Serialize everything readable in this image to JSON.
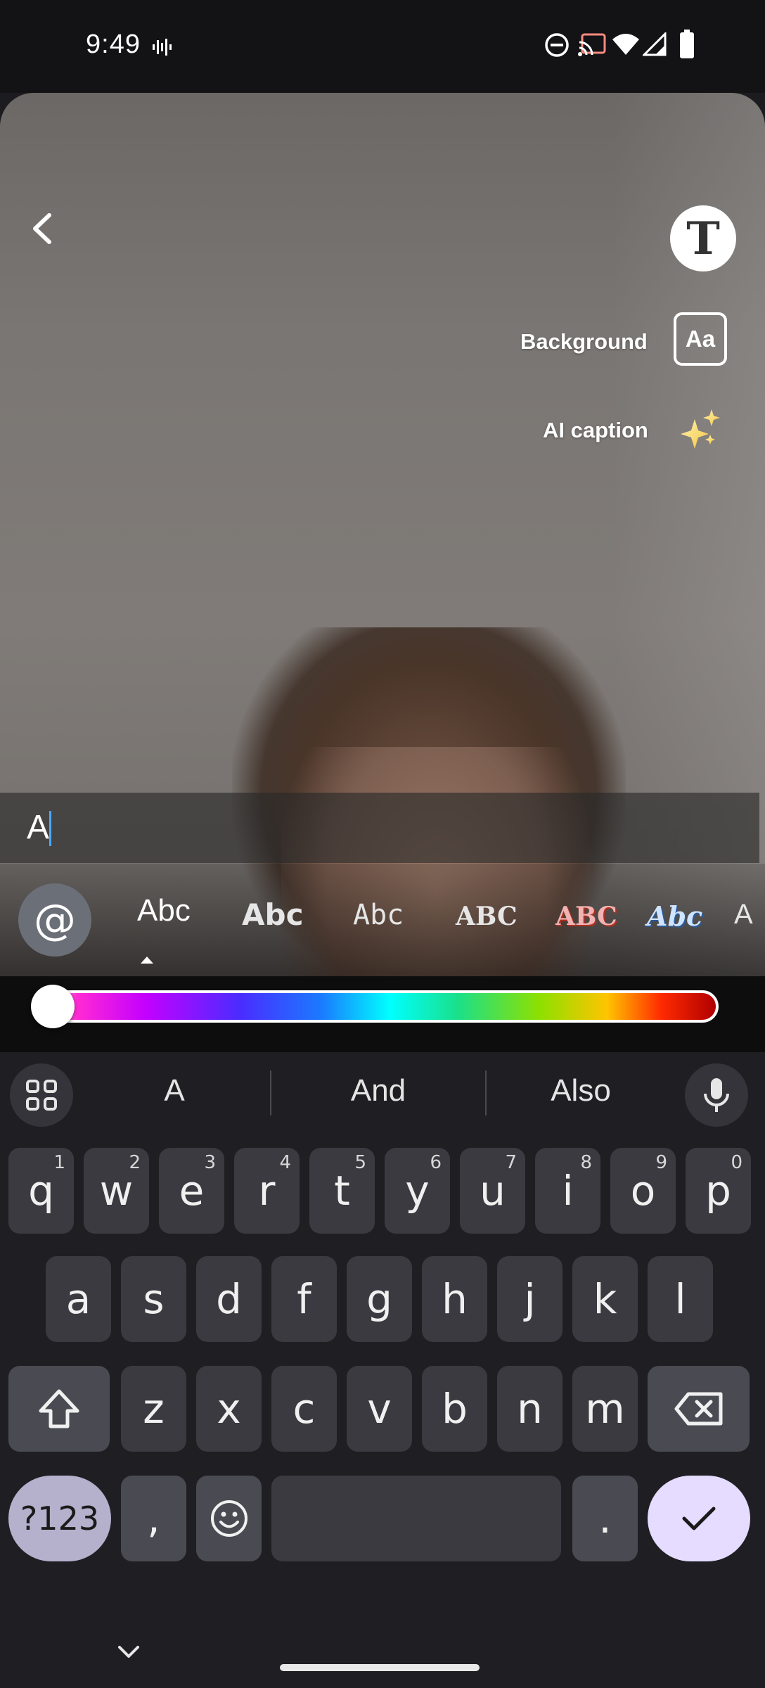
{
  "status_bar": {
    "time": "9:49",
    "icons": [
      "voice-activity-icon",
      "do-not-disturb-icon",
      "cast-icon",
      "wifi-icon",
      "cell-signal-icon",
      "battery-icon"
    ]
  },
  "editor": {
    "text_mode_glyph": "T",
    "background_label": "Background",
    "background_button_label": "Aa",
    "ai_caption_label": "AI caption",
    "caption_text": "A"
  },
  "font_picker": {
    "mention_glyph": "@",
    "options": [
      "Abc",
      "Abc",
      "Abc",
      "ABC",
      "ABC",
      "Abc",
      "A"
    ],
    "selected_index": 0
  },
  "color_slider": {
    "selected_color": "#ffffff",
    "value": 0.0
  },
  "keyboard": {
    "suggestions": [
      "A",
      "And",
      "Also"
    ],
    "row1": [
      {
        "key": "q",
        "hint": "1"
      },
      {
        "key": "w",
        "hint": "2"
      },
      {
        "key": "e",
        "hint": "3"
      },
      {
        "key": "r",
        "hint": "4"
      },
      {
        "key": "t",
        "hint": "5"
      },
      {
        "key": "y",
        "hint": "6"
      },
      {
        "key": "u",
        "hint": "7"
      },
      {
        "key": "i",
        "hint": "8"
      },
      {
        "key": "o",
        "hint": "9"
      },
      {
        "key": "p",
        "hint": "0"
      }
    ],
    "row2": [
      "a",
      "s",
      "d",
      "f",
      "g",
      "h",
      "j",
      "k",
      "l"
    ],
    "row3": [
      "z",
      "x",
      "c",
      "v",
      "b",
      "n",
      "m"
    ],
    "symbols_label": "?123",
    "comma_label": ",",
    "period_label": "."
  },
  "colors": {
    "accent": "#e5dcff",
    "cursor": "#4aa8ff",
    "keyboard_bg": "#1f1f23",
    "key_bg": "#3a3a40"
  }
}
